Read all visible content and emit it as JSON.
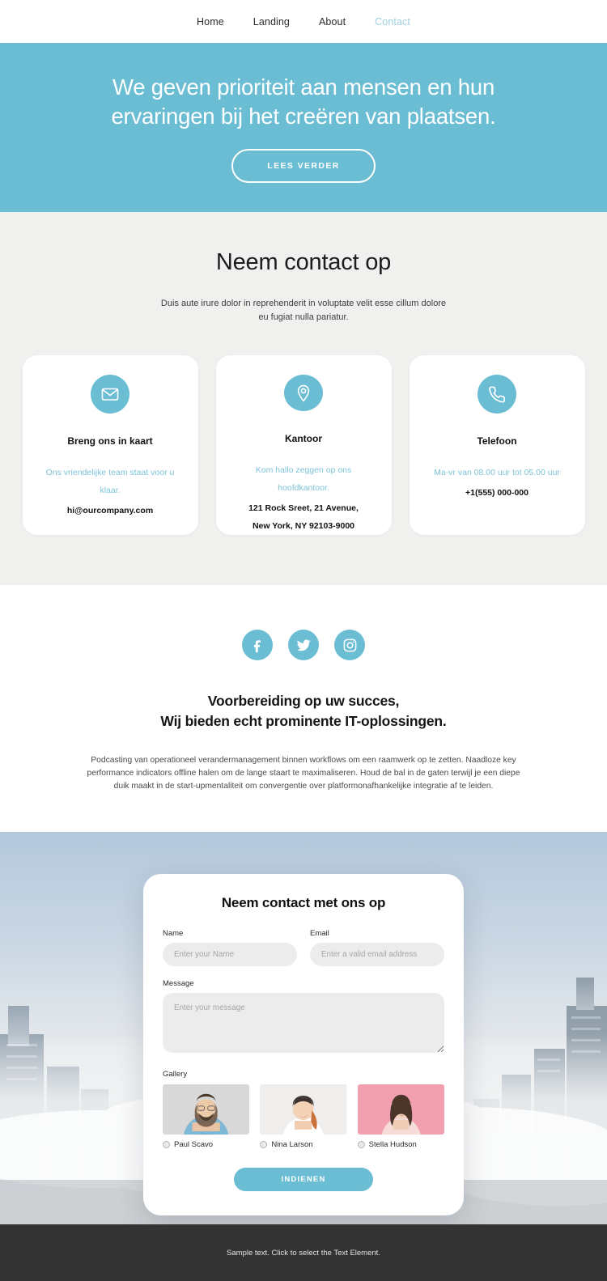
{
  "nav": {
    "items": [
      {
        "label": "Home",
        "active": false
      },
      {
        "label": "Landing",
        "active": false
      },
      {
        "label": "About",
        "active": false
      },
      {
        "label": "Contact",
        "active": true
      }
    ]
  },
  "hero": {
    "title": "We geven prioriteit aan mensen en hun ervaringen bij het creëren van plaatsen.",
    "button": "LEES VERDER",
    "bg_color": "#6bbdd4"
  },
  "contact": {
    "title": "Neem contact op",
    "subtitle": "Duis aute irure dolor in reprehenderit in voluptate velit esse cillum dolore eu fugiat nulla pariatur.",
    "cards": [
      {
        "icon": "envelope-icon",
        "title": "Breng ons in kaart",
        "desc": "Ons vriendelijke team staat voor u klaar.",
        "value": "hi@ourcompany.com"
      },
      {
        "icon": "map-pin-icon",
        "title": "Kantoor",
        "desc": "Kom hallo zeggen op ons hoofdkantoor.",
        "value": "121 Rock Sreet, 21 Avenue,\nNew York, NY 92103-9000"
      },
      {
        "icon": "phone-icon",
        "title": "Telefoon",
        "desc": "Ma-vr van 08.00 uur tot 05.00 uur",
        "value": "+1(555) 000-000"
      }
    ]
  },
  "info": {
    "socials": [
      {
        "name": "facebook-icon",
        "label": "Facebook"
      },
      {
        "name": "twitter-icon",
        "label": "Twitter"
      },
      {
        "name": "instagram-icon",
        "label": "Instagram"
      }
    ],
    "title": "Voorbereiding op uw succes,\nWij bieden echt prominente IT-oplossingen.",
    "body": "Podcasting van operationeel verandermanagement binnen workflows om een raamwerk op te zetten. Naadloze key performance indicators offline halen om de lange staart te maximaliseren. Houd de bal in de gaten terwijl je een diepe duik maakt in de start-upmentaliteit om convergentie over platformonafhankelijke integratie af te leiden."
  },
  "form": {
    "title": "Neem contact met ons op",
    "name_label": "Name",
    "name_placeholder": "Enter your Name",
    "name_value": "",
    "email_label": "Email",
    "email_placeholder": "Enter a valid email address",
    "email_value": "",
    "message_label": "Message",
    "message_placeholder": "Enter your message",
    "message_value": "",
    "gallery_label": "Gallery",
    "gallery": [
      {
        "name": "Paul Scavo",
        "selected": false
      },
      {
        "name": "Nina Larson",
        "selected": false
      },
      {
        "name": "Stella Hudson",
        "selected": false
      }
    ],
    "submit": "INDIENEN"
  },
  "footer": {
    "text": "Sample text. Click to select the Text Element."
  }
}
